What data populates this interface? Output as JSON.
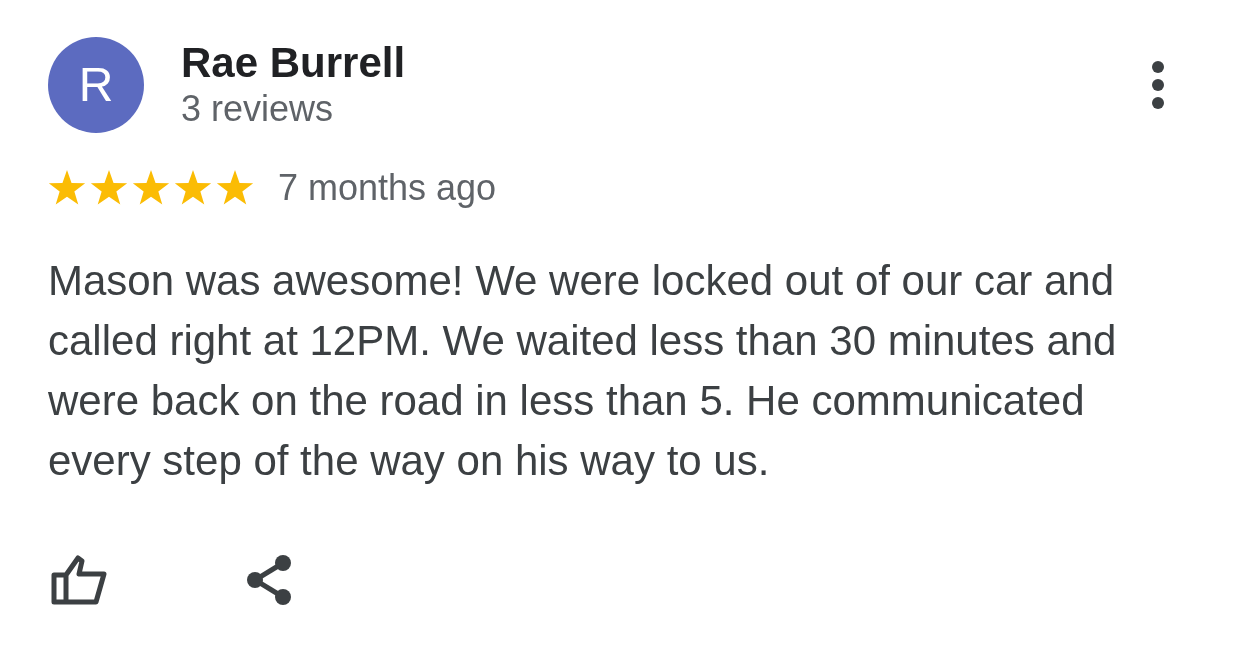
{
  "review": {
    "avatar_initial": "R",
    "author": "Rae Burrell",
    "review_count": "3 reviews",
    "stars": 5,
    "time": "7 months ago",
    "text": "Mason was awesome! We were locked out of our car and called right at 12PM. We waited less than 30 minutes and were back on the road in less than 5. He communicated every step of the way on his way to us."
  }
}
